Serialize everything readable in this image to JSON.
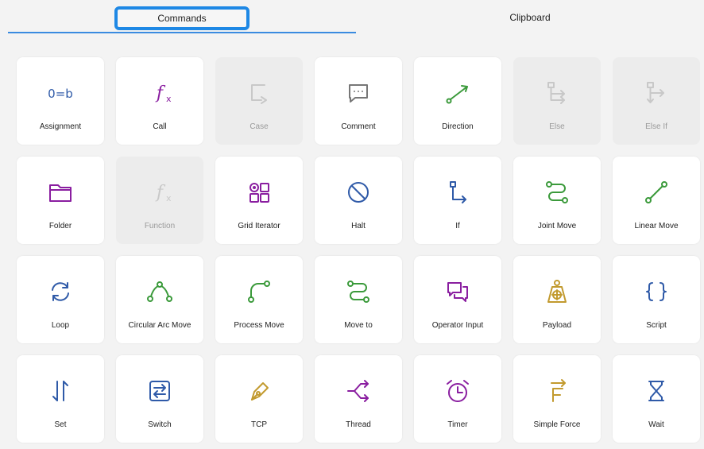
{
  "tabs": {
    "commands": "Commands",
    "clipboard": "Clipboard"
  },
  "colors": {
    "accent": "#1e88e5",
    "blue": "#2f5aa8",
    "purple": "#8a1ea0",
    "green": "#3b9a3b",
    "gold": "#c29a2e",
    "gray": "#888888"
  },
  "tiles": [
    {
      "label": "Assignment",
      "icon": "assignment-icon",
      "color": "#2f5aa8",
      "disabled": false
    },
    {
      "label": "Call",
      "icon": "function-fx-icon",
      "color": "#8a1ea0",
      "disabled": false
    },
    {
      "label": "Case",
      "icon": "case-icon",
      "color": "#888888",
      "disabled": true
    },
    {
      "label": "Comment",
      "icon": "comment-icon",
      "color": "#777777",
      "disabled": false
    },
    {
      "label": "Direction",
      "icon": "direction-arrow-icon",
      "color": "#3b9a3b",
      "disabled": false
    },
    {
      "label": "Else",
      "icon": "else-icon",
      "color": "#888888",
      "disabled": true
    },
    {
      "label": "Else If",
      "icon": "else-if-icon",
      "color": "#888888",
      "disabled": true
    },
    {
      "label": "Folder",
      "icon": "folder-icon",
      "color": "#8a1ea0",
      "disabled": false
    },
    {
      "label": "Function",
      "icon": "function-fx-icon",
      "color": "#888888",
      "disabled": true
    },
    {
      "label": "Grid Iterator",
      "icon": "grid-iterator-icon",
      "color": "#8a1ea0",
      "disabled": false
    },
    {
      "label": "Halt",
      "icon": "halt-icon",
      "color": "#2f5aa8",
      "disabled": false
    },
    {
      "label": "If",
      "icon": "if-branch-icon",
      "color": "#2f5aa8",
      "disabled": false
    },
    {
      "label": "Joint Move",
      "icon": "joint-move-icon",
      "color": "#3b9a3b",
      "disabled": false
    },
    {
      "label": "Linear Move",
      "icon": "linear-move-icon",
      "color": "#3b9a3b",
      "disabled": false
    },
    {
      "label": "Loop",
      "icon": "loop-icon",
      "color": "#2f5aa8",
      "disabled": false
    },
    {
      "label": "Circular Arc Move",
      "icon": "circular-arc-move-icon",
      "color": "#3b9a3b",
      "disabled": false
    },
    {
      "label": "Process Move",
      "icon": "process-move-icon",
      "color": "#3b9a3b",
      "disabled": false
    },
    {
      "label": "Move to",
      "icon": "move-to-icon",
      "color": "#3b9a3b",
      "disabled": false
    },
    {
      "label": "Operator Input",
      "icon": "operator-input-icon",
      "color": "#8a1ea0",
      "disabled": false
    },
    {
      "label": "Payload",
      "icon": "payload-icon",
      "color": "#c29a2e",
      "disabled": false
    },
    {
      "label": "Script",
      "icon": "script-braces-icon",
      "color": "#2f5aa8",
      "disabled": false
    },
    {
      "label": "Set",
      "icon": "set-arrows-icon",
      "color": "#2f5aa8",
      "disabled": false
    },
    {
      "label": "Switch",
      "icon": "switch-icon",
      "color": "#2f5aa8",
      "disabled": false
    },
    {
      "label": "TCP",
      "icon": "tcp-pen-icon",
      "color": "#c29a2e",
      "disabled": false
    },
    {
      "label": "Thread",
      "icon": "thread-icon",
      "color": "#8a1ea0",
      "disabled": false
    },
    {
      "label": "Timer",
      "icon": "timer-icon",
      "color": "#8a1ea0",
      "disabled": false
    },
    {
      "label": "Simple Force",
      "icon": "simple-force-icon",
      "color": "#c29a2e",
      "disabled": false
    },
    {
      "label": "Wait",
      "icon": "wait-hourglass-icon",
      "color": "#2f5aa8",
      "disabled": false
    }
  ]
}
